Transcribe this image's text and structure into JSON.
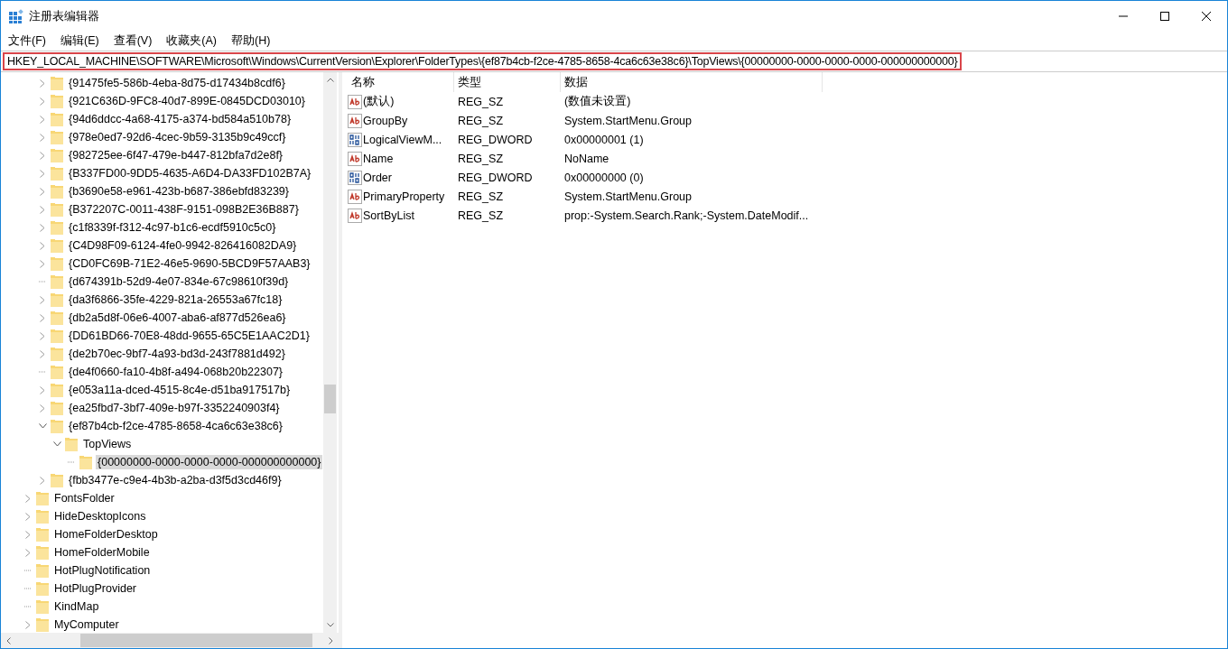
{
  "window": {
    "title": "注册表编辑器"
  },
  "menu": [
    "文件(F)",
    "编辑(E)",
    "查看(V)",
    "收藏夹(A)",
    "帮助(H)"
  ],
  "address_bar": {
    "value": "HKEY_LOCAL_MACHINE\\SOFTWARE\\Microsoft\\Windows\\CurrentVersion\\Explorer\\FolderTypes\\{ef87b4cb-f2ce-4785-8658-4ca6c63e38c6}\\TopViews\\{00000000-0000-0000-0000-000000000000}",
    "highlighted": true
  },
  "tree": {
    "nodes": [
      {
        "children": [
          {
            "label": "{91475fe5-586b-4eba-8d75-d17434b8cdf6}",
            "has_children": true,
            "expanded": false,
            "selected": false
          },
          {
            "label": "{921C636D-9FC8-40d7-899E-0845DCD03010}",
            "has_children": true,
            "expanded": false,
            "selected": false
          },
          {
            "label": "{94d6ddcc-4a68-4175-a374-bd584a510b78}",
            "has_children": true,
            "expanded": false,
            "selected": false
          },
          {
            "label": "{978e0ed7-92d6-4cec-9b59-3135b9c49ccf}",
            "has_children": true,
            "expanded": false,
            "selected": false
          },
          {
            "label": "{982725ee-6f47-479e-b447-812bfa7d2e8f}",
            "has_children": true,
            "expanded": false,
            "selected": false
          },
          {
            "label": "{B337FD00-9DD5-4635-A6D4-DA33FD102B7A}",
            "has_children": true,
            "expanded": false,
            "selected": false
          },
          {
            "label": "{b3690e58-e961-423b-b687-386ebfd83239}",
            "has_children": true,
            "expanded": false,
            "selected": false
          },
          {
            "label": "{B372207C-0011-438F-9151-098B2E36B887}",
            "has_children": true,
            "expanded": false,
            "selected": false
          },
          {
            "label": "{c1f8339f-f312-4c97-b1c6-ecdf5910c5c0}",
            "has_children": true,
            "expanded": false,
            "selected": false
          },
          {
            "label": "{C4D98F09-6124-4fe0-9942-826416082DA9}",
            "has_children": true,
            "expanded": false,
            "selected": false
          },
          {
            "label": "{CD0FC69B-71E2-46e5-9690-5BCD9F57AAB3}",
            "has_children": true,
            "expanded": false,
            "selected": false
          },
          {
            "label": "{d674391b-52d9-4e07-834e-67c98610f39d}",
            "has_children": false,
            "selected": false
          },
          {
            "label": "{da3f6866-35fe-4229-821a-26553a67fc18}",
            "has_children": true,
            "expanded": false,
            "selected": false
          },
          {
            "label": "{db2a5d8f-06e6-4007-aba6-af877d526ea6}",
            "has_children": true,
            "expanded": false,
            "selected": false
          },
          {
            "label": "{DD61BD66-70E8-48dd-9655-65C5E1AAC2D1}",
            "has_children": true,
            "expanded": false,
            "selected": false
          },
          {
            "label": "{de2b70ec-9bf7-4a93-bd3d-243f7881d492}",
            "has_children": true,
            "expanded": false,
            "selected": false
          },
          {
            "label": "{de4f0660-fa10-4b8f-a494-068b20b22307}",
            "has_children": false,
            "selected": false
          },
          {
            "label": "{e053a11a-dced-4515-8c4e-d51ba917517b}",
            "has_children": true,
            "expanded": false,
            "selected": false
          },
          {
            "label": "{ea25fbd7-3bf7-409e-b97f-3352240903f4}",
            "has_children": true,
            "expanded": false,
            "selected": false
          },
          {
            "label": "{ef87b4cb-f2ce-4785-8658-4ca6c63e38c6}",
            "has_children": true,
            "expanded": true,
            "selected": false,
            "children": [
              {
                "label": "TopViews",
                "has_children": true,
                "expanded": true,
                "selected": false,
                "children": [
                  {
                    "label": "{00000000-0000-0000-0000-000000000000}",
                    "has_children": false,
                    "selected": true
                  }
                ]
              }
            ]
          },
          {
            "label": "{fbb3477e-c9e4-4b3b-a2ba-d3f5d3cd46f9}",
            "has_children": true,
            "expanded": false,
            "selected": false
          }
        ]
      },
      {
        "label": "FontsFolder",
        "has_children": true,
        "expanded": false,
        "selected": false
      },
      {
        "label": "HideDesktopIcons",
        "has_children": true,
        "expanded": false,
        "selected": false
      },
      {
        "label": "HomeFolderDesktop",
        "has_children": true,
        "expanded": false,
        "selected": false
      },
      {
        "label": "HomeFolderMobile",
        "has_children": true,
        "expanded": false,
        "selected": false
      },
      {
        "label": "HotPlugNotification",
        "has_children": false,
        "selected": false
      },
      {
        "label": "HotPlugProvider",
        "has_children": false,
        "selected": false
      },
      {
        "label": "KindMap",
        "has_children": false,
        "selected": false
      },
      {
        "label": "MyComputer",
        "has_children": true,
        "expanded": false,
        "selected": false
      }
    ]
  },
  "values": {
    "columns": [
      "名称",
      "类型",
      "数据"
    ],
    "rows": [
      {
        "kind": "string",
        "name": "(默认)",
        "type": "REG_SZ",
        "data": "(数值未设置)"
      },
      {
        "kind": "string",
        "name": "GroupBy",
        "type": "REG_SZ",
        "data": "System.StartMenu.Group"
      },
      {
        "kind": "binary",
        "name": "LogicalViewM...",
        "type": "REG_DWORD",
        "data": "0x00000001 (1)"
      },
      {
        "kind": "string",
        "name": "Name",
        "type": "REG_SZ",
        "data": "NoName"
      },
      {
        "kind": "binary",
        "name": "Order",
        "type": "REG_DWORD",
        "data": "0x00000000 (0)"
      },
      {
        "kind": "string",
        "name": "PrimaryProperty",
        "type": "REG_SZ",
        "data": "System.StartMenu.Group"
      },
      {
        "kind": "string",
        "name": "SortByList",
        "type": "REG_SZ",
        "data": "prop:-System.Search.Rank;-System.DateModif..."
      }
    ]
  }
}
